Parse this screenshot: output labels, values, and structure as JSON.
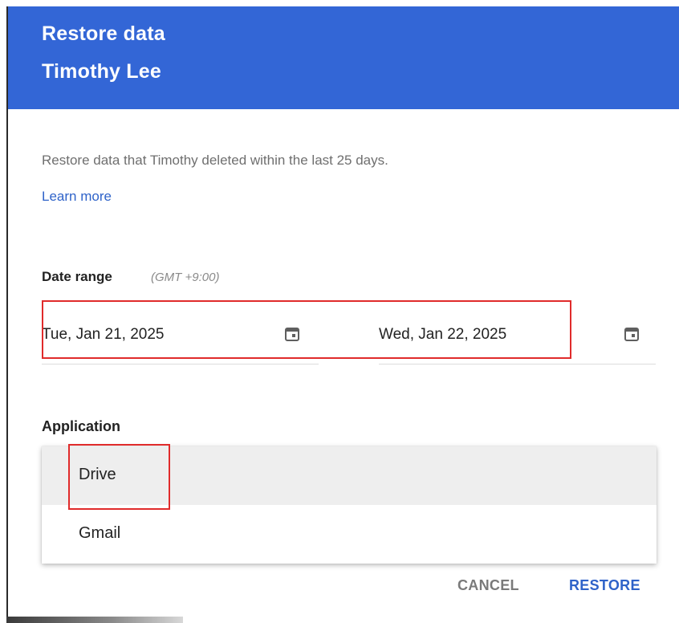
{
  "dialog": {
    "title": "Restore data",
    "subtitle": "Timothy Lee",
    "description": "Restore data that Timothy deleted within the last 25 days.",
    "learn_more": "Learn more"
  },
  "date_range": {
    "label": "Date range",
    "timezone": "(GMT +9:00)",
    "start": "Tue, Jan 21, 2025",
    "end": "Wed, Jan 22, 2025",
    "icon": "calendar-icon"
  },
  "application": {
    "label": "Application",
    "options": [
      {
        "label": "Drive",
        "selected": true
      },
      {
        "label": "Gmail",
        "selected": false
      }
    ]
  },
  "actions": {
    "cancel": "CANCEL",
    "restore": "RESTORE"
  },
  "colors": {
    "header": "#3366d6",
    "accent": "#2f63c9",
    "highlight": "#e02b2b"
  }
}
